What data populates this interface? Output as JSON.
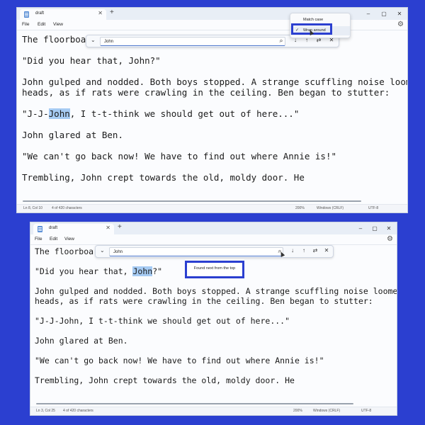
{
  "window1": {
    "tab_title": "draft",
    "menu": [
      "File",
      "Edit",
      "View"
    ],
    "document": {
      "line1": "The floorboar",
      "line2": "\"Did you hear that, John?\"",
      "line3": "John gulped and nodded. Both boys stopped. A strange scuffling noise loomed ov",
      "line4": "heads, as if rats were crawling in the ceiling. Ben began to stutter:",
      "line5_before": "\"J-J-",
      "line5_match": "John",
      "line5_after": ", I t-t-think we should get out of here...\"",
      "line6": "John glared at Ben.",
      "line7": "\"We can't go back now! We have to find out where Annie is!\"",
      "line8": "Trembling, John crept towards the old, moldy door. He"
    },
    "find": {
      "value": "John"
    },
    "options": {
      "match_case": "Match case",
      "wrap_around": "Wrap around",
      "wrap_checked": "✓"
    },
    "status": {
      "position": "Ln 8, Col 10",
      "chars": "4 of 420 characters",
      "zoom": "200%",
      "line_ending": "Windows (CRLF)",
      "encoding": "UTF-8"
    }
  },
  "window2": {
    "tab_title": "draft",
    "menu": [
      "File",
      "Edit",
      "View"
    ],
    "document": {
      "line1": "The floorboar",
      "line2_before": "\"Did you hear that, ",
      "line2_match": "John",
      "line2_after": "?\"",
      "line3": "John gulped and nodded. Both boys stopped. A strange scuffling noise loomed ov",
      "line4": "heads, as if rats were crawling in the ceiling. Ben began to stutter:",
      "line5": "\"J-J-John, I t-t-think we should get out of here...\"",
      "line6": "John glared at Ben.",
      "line7": "\"We can't go back now! We have to find out where Annie is!\"",
      "line8": "Trembling, John crept towards the old, moldy door. He"
    },
    "find": {
      "value": "John"
    },
    "tooltip": "Found next from the top",
    "status": {
      "position": "Ln 3, Col 25",
      "chars": "4 of 420 characters",
      "zoom": "200%",
      "line_ending": "Windows (CRLF)",
      "encoding": "UTF-8"
    }
  },
  "icons": {
    "search": "⌕",
    "next": "↓",
    "prev": "↑",
    "replace": "⇄",
    "close": "✕",
    "chevron": "⌄",
    "new_tab": "+",
    "minimize": "–",
    "maximize": "▢",
    "settings": "⚙"
  },
  "colors": {
    "background": "#2b3fd0",
    "highlight": "#a6cbf3",
    "callout": "#2b3fd0"
  }
}
